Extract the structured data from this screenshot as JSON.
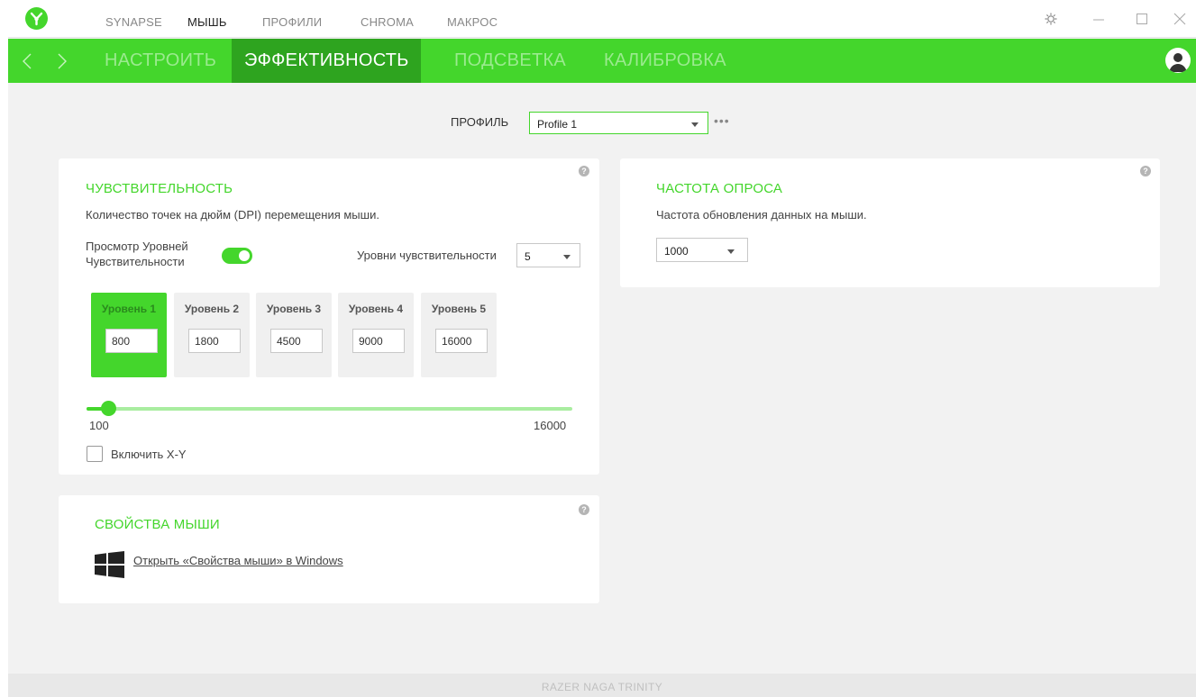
{
  "top_nav": {
    "items": [
      "SYNAPSE",
      "МЫШЬ",
      "ПРОФИЛИ",
      "CHROMA",
      "МАКРОС"
    ],
    "active": "МЫШЬ"
  },
  "tabs": {
    "items": [
      "НАСТРОИТЬ",
      "ЭФФЕКТИВНОСТЬ",
      "ПОДСВЕТКА",
      "КАЛИБРОВКА"
    ],
    "active": "ЭФФЕКТИВНОСТЬ"
  },
  "profile": {
    "label": "ПРОФИЛЬ",
    "value": "Profile 1",
    "more": "•••"
  },
  "sensitivity": {
    "help": "?",
    "title": "ЧУВСТВИТЕЛЬНОСТЬ",
    "description": "Количество точек на дюйм (DPI) перемещения мыши.",
    "toggle_label": "Просмотр Уровней Чувствительности",
    "toggle_on": true,
    "levels_label": "Уровни чувствительности",
    "levels_value": "5",
    "levels": [
      {
        "name": "Уровень 1",
        "value": "800",
        "active": true
      },
      {
        "name": "Уровень 2",
        "value": "1800",
        "active": false
      },
      {
        "name": "Уровень 3",
        "value": "4500",
        "active": false
      },
      {
        "name": "Уровень 4",
        "value": "9000",
        "active": false
      },
      {
        "name": "Уровень 5",
        "value": "16000",
        "active": false
      }
    ],
    "slider": {
      "min": "100",
      "max": "16000",
      "current": 800
    },
    "xy_label": "Включить X-Y",
    "xy_checked": false
  },
  "mouse_props": {
    "help": "?",
    "title": "СВОЙСТВА МЫШИ",
    "link": "Открыть «Свойства мыши» в Windows",
    "icon": "windows-logo-icon"
  },
  "polling": {
    "help": "?",
    "title": "ЧАСТОТА ОПРОСА",
    "description": "Частота обновления данных на мыши.",
    "value": "1000"
  },
  "footer": {
    "device": "RAZER NAGA TRINITY"
  },
  "colors": {
    "accent": "#44d62c",
    "accent_dark": "#2ea41f",
    "background": "#f2f2f2"
  }
}
